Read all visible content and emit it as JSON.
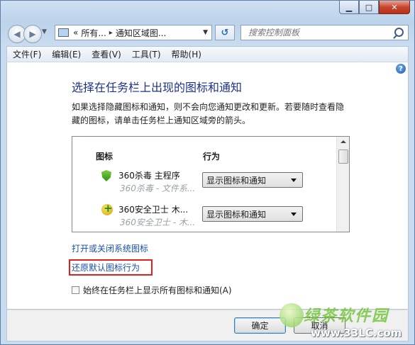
{
  "window": {
    "minimize_icon": "minimize-icon",
    "maximize_icon": "maximize-icon",
    "close_icon": "close-icon"
  },
  "nav": {
    "address_prefix": "«",
    "crumbs": [
      "所有...",
      "通知区域图..."
    ],
    "search_placeholder": "搜索控制面板"
  },
  "menu": [
    "文件(F)",
    "编辑(E)",
    "查看(V)",
    "工具(T)",
    "帮助(H)"
  ],
  "main": {
    "title": "选择在任务栏上出现的图标和通知",
    "description": "如果选择隐藏图标和通知，则不会向您通知更改和更新。若要随时查看隐藏的图标，请单击任务栏上通知区域旁的箭头。",
    "list_headers": {
      "icon": "图标",
      "behavior": "行为"
    },
    "rows": [
      {
        "name": "360杀毒 主程序",
        "sub": "360杀毒 - 文件系...",
        "behavior": "显示图标和通知",
        "icon": "360-antivirus-icon"
      },
      {
        "name": "360安全卫士 木...",
        "sub": "360安全卫士 - 木...",
        "behavior": "显示图标和通知",
        "icon": "360-safeguard-icon"
      }
    ],
    "link_system_icons": "打开或关闭系统图标",
    "link_restore": "还原默认图标行为",
    "always_show_label": "始终在任务栏上显示所有图标和通知(A)",
    "always_show_checked": false
  },
  "footer": {
    "ok": "确定",
    "cancel": "取消"
  },
  "watermark": {
    "site": "绿茶软件园",
    "url": "www.33LC.com"
  },
  "colors": {
    "link": "#1a4fa8",
    "title": "#1e3287",
    "highlight_box": "#e0201a"
  }
}
